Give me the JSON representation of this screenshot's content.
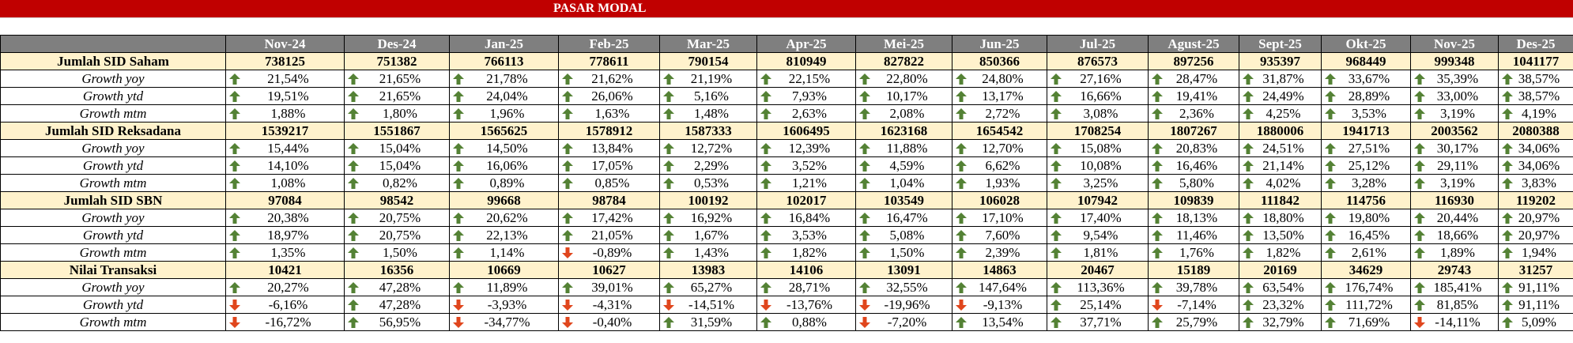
{
  "title": "PASAR MODAL",
  "colors": {
    "banner": "#c00000",
    "header_bg": "#7f7f7f",
    "section_bg": "#fff2cc",
    "up": "#548235",
    "down": "#e0461d"
  },
  "months": [
    "Nov-24",
    "Des-24",
    "Jan-25",
    "Feb-25",
    "Mar-25",
    "Apr-25",
    "Mei-25",
    "Jun-25",
    "Jul-25",
    "Agust-25",
    "Sept-25",
    "Okt-25",
    "Nov-25",
    "Des-25"
  ],
  "sections": [
    {
      "label": "Jumlah SID Saham",
      "values": [
        "738125",
        "751382",
        "766113",
        "778611",
        "790154",
        "810949",
        "827822",
        "850366",
        "876573",
        "897256",
        "935397",
        "968449",
        "999348",
        "1041177"
      ],
      "rows": [
        {
          "label": "Growth yoy",
          "values": [
            "21,54%",
            "21,65%",
            "21,78%",
            "21,62%",
            "21,19%",
            "22,15%",
            "22,80%",
            "24,80%",
            "27,16%",
            "28,47%",
            "31,87%",
            "33,67%",
            "35,39%",
            "38,57%"
          ],
          "dirs": [
            "up",
            "up",
            "up",
            "up",
            "up",
            "up",
            "up",
            "up",
            "up",
            "up",
            "up",
            "up",
            "up",
            "up"
          ]
        },
        {
          "label": "Growth ytd",
          "values": [
            "19,51%",
            "21,65%",
            "24,04%",
            "26,06%",
            "5,16%",
            "7,93%",
            "10,17%",
            "13,17%",
            "16,66%",
            "19,41%",
            "24,49%",
            "28,89%",
            "33,00%",
            "38,57%"
          ],
          "dirs": [
            "up",
            "up",
            "up",
            "up",
            "up",
            "up",
            "up",
            "up",
            "up",
            "up",
            "up",
            "up",
            "up",
            "up"
          ]
        },
        {
          "label": "Growth mtm",
          "values": [
            "1,88%",
            "1,80%",
            "1,96%",
            "1,63%",
            "1,48%",
            "2,63%",
            "2,08%",
            "2,72%",
            "3,08%",
            "2,36%",
            "4,25%",
            "3,53%",
            "3,19%",
            "4,19%"
          ],
          "dirs": [
            "up",
            "up",
            "up",
            "up",
            "up",
            "up",
            "up",
            "up",
            "up",
            "up",
            "up",
            "up",
            "up",
            "up"
          ]
        }
      ]
    },
    {
      "label": "Jumlah SID Reksadana",
      "values": [
        "1539217",
        "1551867",
        "1565625",
        "1578912",
        "1587333",
        "1606495",
        "1623168",
        "1654542",
        "1708254",
        "1807267",
        "1880006",
        "1941713",
        "2003562",
        "2080388"
      ],
      "rows": [
        {
          "label": "Growth yoy",
          "values": [
            "15,44%",
            "15,04%",
            "14,50%",
            "13,84%",
            "12,72%",
            "12,39%",
            "11,88%",
            "12,70%",
            "15,08%",
            "20,83%",
            "24,51%",
            "27,51%",
            "30,17%",
            "34,06%"
          ],
          "dirs": [
            "up",
            "up",
            "up",
            "up",
            "up",
            "up",
            "up",
            "up",
            "up",
            "up",
            "up",
            "up",
            "up",
            "up"
          ]
        },
        {
          "label": "Growth ytd",
          "values": [
            "14,10%",
            "15,04%",
            "16,06%",
            "17,05%",
            "2,29%",
            "3,52%",
            "4,59%",
            "6,62%",
            "10,08%",
            "16,46%",
            "21,14%",
            "25,12%",
            "29,11%",
            "34,06%"
          ],
          "dirs": [
            "up",
            "up",
            "up",
            "up",
            "up",
            "up",
            "up",
            "up",
            "up",
            "up",
            "up",
            "up",
            "up",
            "up"
          ]
        },
        {
          "label": "Growth mtm",
          "values": [
            "1,08%",
            "0,82%",
            "0,89%",
            "0,85%",
            "0,53%",
            "1,21%",
            "1,04%",
            "1,93%",
            "3,25%",
            "5,80%",
            "4,02%",
            "3,28%",
            "3,19%",
            "3,83%"
          ],
          "dirs": [
            "up",
            "up",
            "up",
            "up",
            "up",
            "up",
            "up",
            "up",
            "up",
            "up",
            "up",
            "up",
            "up",
            "up"
          ]
        }
      ]
    },
    {
      "label": "Jumlah SID SBN",
      "values": [
        "97084",
        "98542",
        "99668",
        "98784",
        "100192",
        "102017",
        "103549",
        "106028",
        "107942",
        "109839",
        "111842",
        "114756",
        "116930",
        "119202"
      ],
      "rows": [
        {
          "label": "Growth yoy",
          "values": [
            "20,38%",
            "20,75%",
            "20,62%",
            "17,42%",
            "16,92%",
            "16,84%",
            "16,47%",
            "17,10%",
            "17,40%",
            "18,13%",
            "18,80%",
            "19,80%",
            "20,44%",
            "20,97%"
          ],
          "dirs": [
            "up",
            "up",
            "up",
            "up",
            "up",
            "up",
            "up",
            "up",
            "up",
            "up",
            "up",
            "up",
            "up",
            "up"
          ]
        },
        {
          "label": "Growth ytd",
          "values": [
            "18,97%",
            "20,75%",
            "22,13%",
            "21,05%",
            "1,67%",
            "3,53%",
            "5,08%",
            "7,60%",
            "9,54%",
            "11,46%",
            "13,50%",
            "16,45%",
            "18,66%",
            "20,97%"
          ],
          "dirs": [
            "up",
            "up",
            "up",
            "up",
            "up",
            "up",
            "up",
            "up",
            "up",
            "up",
            "up",
            "up",
            "up",
            "up"
          ]
        },
        {
          "label": "Growth mtm",
          "values": [
            "1,35%",
            "1,50%",
            "1,14%",
            "-0,89%",
            "1,43%",
            "1,82%",
            "1,50%",
            "2,39%",
            "1,81%",
            "1,76%",
            "1,82%",
            "2,61%",
            "1,89%",
            "1,94%"
          ],
          "dirs": [
            "up",
            "up",
            "up",
            "down",
            "up",
            "up",
            "up",
            "up",
            "up",
            "up",
            "up",
            "up",
            "up",
            "up"
          ]
        }
      ]
    },
    {
      "label": "Nilai Transaksi",
      "values": [
        "10421",
        "16356",
        "10669",
        "10627",
        "13983",
        "14106",
        "13091",
        "14863",
        "20467",
        "15189",
        "20169",
        "34629",
        "29743",
        "31257"
      ],
      "rows": [
        {
          "label": "Growth yoy",
          "values": [
            "20,27%",
            "47,28%",
            "11,89%",
            "39,01%",
            "65,27%",
            "28,71%",
            "32,55%",
            "147,64%",
            "113,36%",
            "39,78%",
            "63,54%",
            "176,74%",
            "185,41%",
            "91,11%"
          ],
          "dirs": [
            "up",
            "up",
            "up",
            "up",
            "up",
            "up",
            "up",
            "up",
            "up",
            "up",
            "up",
            "up",
            "up",
            "up"
          ]
        },
        {
          "label": "Growth ytd",
          "values": [
            "-6,16%",
            "47,28%",
            "-3,93%",
            "-4,31%",
            "-14,51%",
            "-13,76%",
            "-19,96%",
            "-9,13%",
            "25,14%",
            "-7,14%",
            "23,32%",
            "111,72%",
            "81,85%",
            "91,11%"
          ],
          "dirs": [
            "down",
            "up",
            "down",
            "down",
            "down",
            "down",
            "down",
            "down",
            "up",
            "down",
            "up",
            "up",
            "up",
            "up"
          ]
        },
        {
          "label": "Growth mtm",
          "values": [
            "-16,72%",
            "56,95%",
            "-34,77%",
            "-0,40%",
            "31,59%",
            "0,88%",
            "-7,20%",
            "13,54%",
            "37,71%",
            "25,79%",
            "32,79%",
            "71,69%",
            "-14,11%",
            "5,09%"
          ],
          "dirs": [
            "down",
            "up",
            "down",
            "down",
            "up",
            "up",
            "down",
            "up",
            "up",
            "up",
            "up",
            "up",
            "down",
            "up"
          ]
        }
      ]
    }
  ]
}
